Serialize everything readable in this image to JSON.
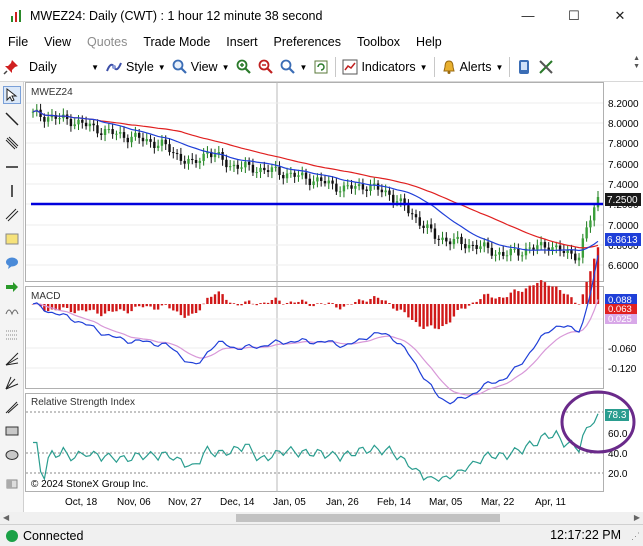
{
  "window": {
    "title": "MWEZ24: Daily (CWT) : 1 hour 12 minute 38 second",
    "minimize": "—",
    "maximize": "☐",
    "close": "✕"
  },
  "menu": [
    "File",
    "View",
    "Quotes",
    "Trade Mode",
    "Insert",
    "Preferences",
    "Toolbox",
    "Help"
  ],
  "toolbar": {
    "interval": "Daily",
    "style": "Style",
    "view": "View",
    "indicators": "Indicators",
    "alerts": "Alerts"
  },
  "chart": {
    "symbol": "MWEZ24",
    "price_labels": [
      "8.2000",
      "8.0000",
      "7.8000",
      "7.6000",
      "7.4000",
      "7.2000",
      "7.0000",
      "6.8000",
      "6.6000"
    ],
    "last_price": "7.2500",
    "ma_value": "6.8613",
    "macd_title": "MACD",
    "macd_labels": [
      "0.060",
      "-0.060",
      "-0.120"
    ],
    "macd_value": "0.088",
    "signal_value": "0.063",
    "hist_value": "0.025",
    "rsi_title": "Relative Strength Index",
    "rsi_labels": [
      "60.0",
      "40.0",
      "20.0"
    ],
    "rsi_value": "78.3",
    "copyright": "© 2024 StoneX Group Inc.",
    "dates": [
      "Oct, 18",
      "Nov, 06",
      "Nov, 27",
      "Dec, 14",
      "Jan, 05",
      "Jan, 26",
      "Feb, 14",
      "Mar, 05",
      "Mar, 22",
      "Apr, 11"
    ]
  },
  "status": {
    "connection": "Connected",
    "time": "12:17:22 PM"
  },
  "colors": {
    "up": "#2a8a2a",
    "hline": "#0000dd",
    "ma_red": "#e02020",
    "ma_blue": "#1f3fd8",
    "rsi": "#2a9d8f",
    "circle": "#6a2a8a"
  }
}
